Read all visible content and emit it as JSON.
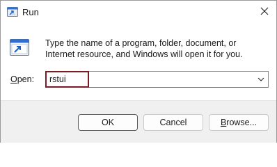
{
  "window": {
    "title": "Run",
    "close_icon": "close-icon",
    "app_icon": "run-icon"
  },
  "description": "Type the name of a program, folder, document, or Internet resource, and Windows will open it for you.",
  "open": {
    "label_access_key": "O",
    "label_rest": "pen:",
    "value": "rstui",
    "dropdown_icon": "chevron-down-icon",
    "highlight_color": "#7b1c24"
  },
  "buttons": {
    "ok_label": "OK",
    "cancel_label": "Cancel",
    "browse_access_key": "B",
    "browse_rest": "rowse..."
  }
}
